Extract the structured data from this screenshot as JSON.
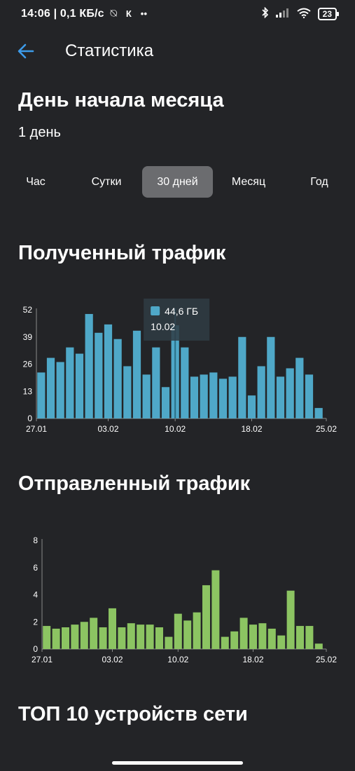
{
  "status_bar": {
    "time": "14:06 | 0,1 КБ/с",
    "network_letter": "К",
    "battery": "23"
  },
  "app_bar": {
    "title": "Статистика"
  },
  "month_start": {
    "title": "День начала месяца",
    "value": "1 день"
  },
  "tabs": [
    {
      "label": "Час",
      "active": false
    },
    {
      "label": "Сутки",
      "active": false
    },
    {
      "label": "30 дней",
      "active": true
    },
    {
      "label": "Месяц",
      "active": false
    },
    {
      "label": "Год",
      "active": false
    }
  ],
  "received": {
    "title": "Полученный трафик"
  },
  "sent": {
    "title": "Отправленный трафик"
  },
  "top10": {
    "title": "ТОП 10 устройств сети"
  },
  "colors": {
    "background": "#232427",
    "received_bar": "#4fa8c8",
    "sent_bar": "#8cc462",
    "accent": "#3d9be9",
    "tab_active": "#6b6c6f"
  },
  "chart_data": [
    {
      "type": "bar",
      "name": "received",
      "x_tick_labels": [
        "27.01",
        "03.02",
        "10.02",
        "18.02",
        "25.02"
      ],
      "y_ticks": [
        0,
        13,
        26,
        39,
        52
      ],
      "ylim": [
        0,
        52
      ],
      "values": [
        22,
        29,
        27,
        34,
        31,
        50,
        41,
        45,
        38,
        25,
        42,
        21,
        34,
        15,
        44.6,
        34,
        20,
        21,
        22,
        19,
        20,
        39,
        11,
        25,
        39,
        20,
        24,
        29,
        21,
        5
      ],
      "highlight": {
        "index": 14,
        "value_label": "44,6 ГБ",
        "date_label": "10.02"
      }
    },
    {
      "type": "bar",
      "name": "sent",
      "x_tick_labels": [
        "27.01",
        "03.02",
        "10.02",
        "18.02",
        "25.02"
      ],
      "y_ticks": [
        0,
        2,
        4,
        6,
        8
      ],
      "ylim": [
        0,
        8
      ],
      "values": [
        1.7,
        1.5,
        1.6,
        1.8,
        2.0,
        2.3,
        1.6,
        3.0,
        1.6,
        1.9,
        1.8,
        1.8,
        1.6,
        0.9,
        2.6,
        2.1,
        2.7,
        4.7,
        5.8,
        0.9,
        1.3,
        2.3,
        1.8,
        1.9,
        1.5,
        1.0,
        4.3,
        1.7,
        1.7,
        0.4
      ]
    }
  ]
}
